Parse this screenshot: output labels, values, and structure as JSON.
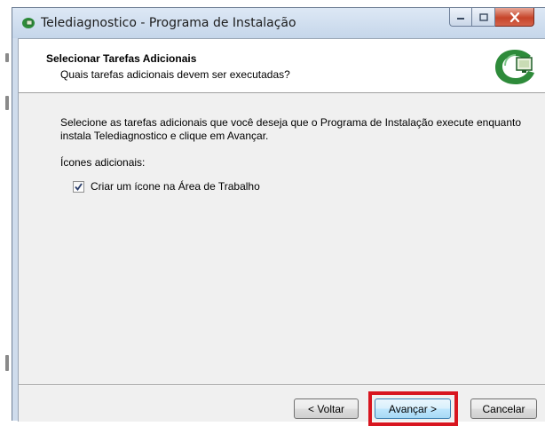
{
  "window": {
    "title": "Telediagnostico - Programa de Instalação"
  },
  "header": {
    "title": "Selecionar Tarefas Adicionais",
    "subtitle": "Quais tarefas adicionais devem ser executadas?"
  },
  "content": {
    "instruction": "Selecione as tarefas adicionais que você deseja que o Programa de Instalação execute enquanto instala Telediagnostico e clique em Avançar.",
    "group_label": "Ícones adicionais:",
    "tasks": [
      {
        "label": "Criar um ícone na Área de Trabalho",
        "checked": true
      }
    ]
  },
  "buttons": {
    "back": "< Voltar",
    "next": "Avançar >",
    "cancel": "Cancelar"
  },
  "colors": {
    "highlight": "#d8151f",
    "logo_green": "#2e8b3a",
    "title_bar": "#c5d6ea"
  },
  "icons": [
    "app-icon",
    "minimize-icon",
    "maximize-icon",
    "close-icon",
    "setup-logo-icon",
    "checkmark-icon"
  ]
}
